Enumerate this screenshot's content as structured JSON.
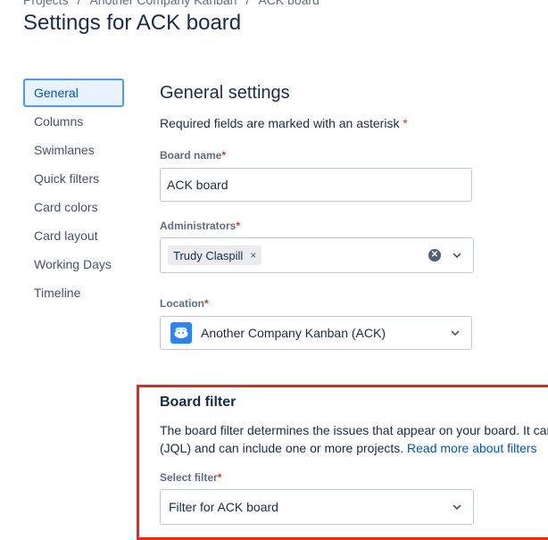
{
  "breadcrumb": {
    "items": [
      "Projects",
      "Another Company Kanban",
      "ACK board"
    ],
    "separator": "/"
  },
  "page_title": "Settings for ACK board",
  "sidebar": {
    "items": [
      {
        "label": "General",
        "active": true
      },
      {
        "label": "Columns"
      },
      {
        "label": "Swimlanes"
      },
      {
        "label": "Quick filters"
      },
      {
        "label": "Card colors"
      },
      {
        "label": "Card layout"
      },
      {
        "label": "Working Days"
      },
      {
        "label": "Timeline"
      }
    ]
  },
  "general": {
    "title": "General settings",
    "required_note": "Required fields are marked with an asterisk",
    "asterisk": "*",
    "board_name": {
      "label": "Board name",
      "value": "ACK board"
    },
    "administrators": {
      "label": "Administrators",
      "tags": [
        "Trudy Claspill"
      ],
      "remove_glyph": "×"
    },
    "location": {
      "label": "Location",
      "value": "Another Company Kanban (ACK)",
      "icon": "project-avatar-icon"
    }
  },
  "board_filter": {
    "title": "Board filter",
    "description_line1": "The board filter determines the issues that appear on your board. It can be based on one or more projects, or custom Jira Query Language",
    "description_line2": "(JQL) and can include one or more projects.",
    "read_more": "Read more about filters",
    "select_label": "Select filter",
    "select_value": "Filter for ACK board"
  },
  "colors": {
    "accent": "#0052cc",
    "highlight": "#f4250e",
    "required": "#de350b"
  }
}
